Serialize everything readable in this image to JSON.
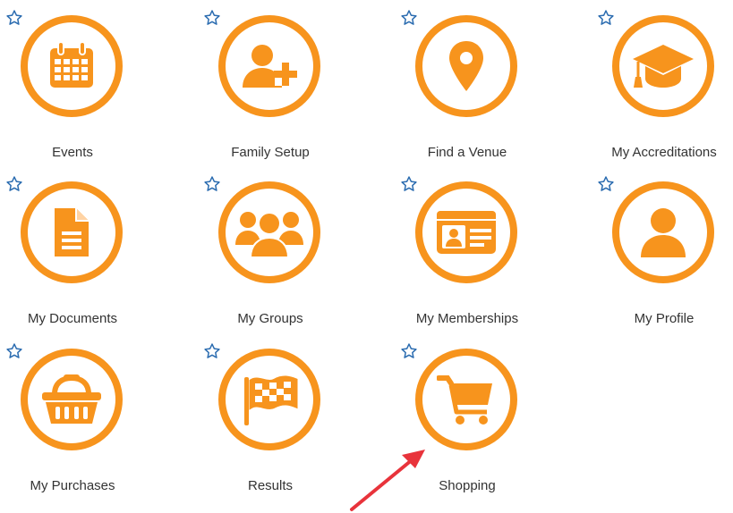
{
  "colors": {
    "accent": "#f7941d",
    "star": "#2b6cb0",
    "arrow": "#e8333b",
    "text": "#333333"
  },
  "tiles": [
    {
      "label": "Events",
      "icon": "calendar-icon"
    },
    {
      "label": "Family Setup",
      "icon": "user-plus-icon"
    },
    {
      "label": "Find a Venue",
      "icon": "map-pin-icon"
    },
    {
      "label": "My Accreditations",
      "icon": "graduation-cap-icon"
    },
    {
      "label": "My Documents",
      "icon": "document-icon"
    },
    {
      "label": "My Groups",
      "icon": "users-icon"
    },
    {
      "label": "My Memberships",
      "icon": "id-card-icon"
    },
    {
      "label": "My Profile",
      "icon": "user-icon"
    },
    {
      "label": "My Purchases",
      "icon": "basket-icon"
    },
    {
      "label": "Results",
      "icon": "checkered-flag-icon"
    },
    {
      "label": "Shopping",
      "icon": "shopping-cart-icon"
    }
  ]
}
